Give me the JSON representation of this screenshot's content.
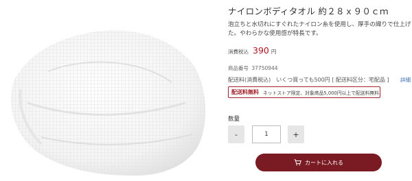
{
  "product": {
    "title": "ナイロンボディタオル 約２８ｘ９０ｃｍ",
    "description_lines": [
      "泡立ちと水切れにすぐれたナイロン糸を使用し、厚手の織りで仕上げまし",
      "た。やわらかな使用感が特長です。"
    ],
    "tax_label": "消費税込",
    "price": "390",
    "yen": "円",
    "code_label": "商品番号",
    "code": "37750944",
    "shipping_text": "配送料(消費税込)　いくつ買っても500円 [ 配送料区分：宅配品 ]",
    "detail_link": "詳細",
    "free_shipping_badge": "配送料無料",
    "free_shipping_note": "ネットストア限定、対象商品5,000円以上で配送料無料"
  },
  "quantity": {
    "label": "数量",
    "minus": "-",
    "value": "1",
    "plus": "+"
  },
  "cart": {
    "label": "カートに入れる",
    "icon": "cart-icon"
  },
  "colors": {
    "accent": "#7a1a22",
    "price": "#b2121e",
    "border_accent": "#a3222c"
  }
}
